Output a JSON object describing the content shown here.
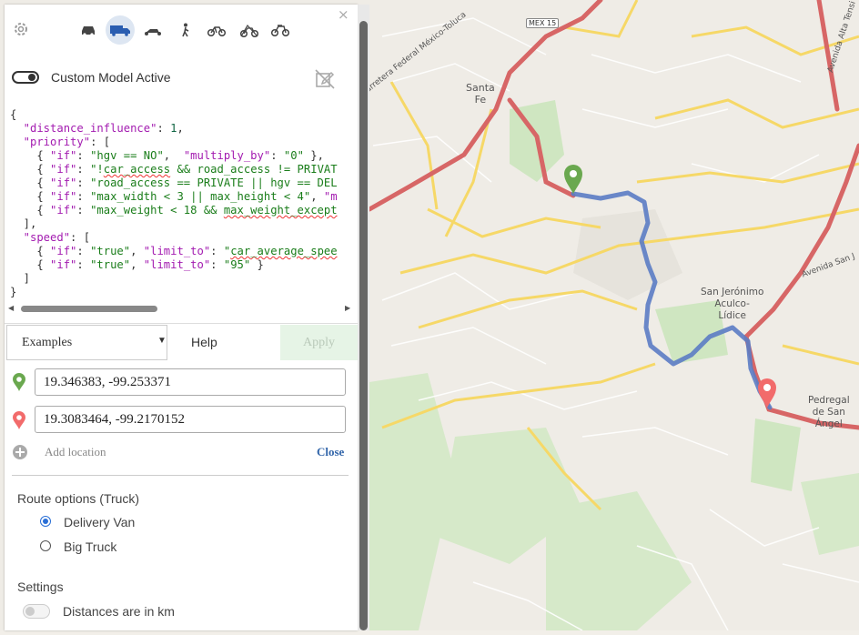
{
  "map": {
    "places": [
      {
        "id": "santa-fe",
        "lines": [
          "Santa",
          "Fe"
        ]
      },
      {
        "id": "san-jeronimo",
        "lines": [
          "San Jerónimo",
          "Aculco-",
          "Lídice"
        ]
      },
      {
        "id": "pedregal",
        "lines": [
          "Pedregal",
          "de San",
          "Ángel"
        ]
      }
    ],
    "roads": {
      "carretera": "Carretera Federal México-Toluca",
      "avenida_alta": "Avenida Alta Tensi",
      "avenida_san_j": "Avenida San J"
    },
    "shield": "MEX 15",
    "start_color": "#6aa84f",
    "end_color": "#f26b6b",
    "route_color": "#5b7cc4"
  },
  "panel": {
    "close_symbol": "×",
    "vehicles": [
      {
        "icon": "car-icon",
        "active": false
      },
      {
        "icon": "truck-icon",
        "active": true
      },
      {
        "icon": "scooter-icon",
        "active": false
      },
      {
        "icon": "walk-icon",
        "active": false
      },
      {
        "icon": "bike-icon",
        "active": false
      },
      {
        "icon": "mountain-bike-icon",
        "active": false
      },
      {
        "icon": "racing-bike-icon",
        "active": false
      }
    ],
    "custom_model_label": "Custom Model Active",
    "code": [
      "{",
      "  \"distance_influence\": 1,",
      "  \"priority\": [",
      "    { \"if\": \"hgv == NO\",  \"multiply_by\": \"0\" },",
      "    { \"if\": \"!car_access && road_access != PRIVAT",
      "    { \"if\": \"road_access == PRIVATE || hgv == DEL",
      "    { \"if\": \"max_width < 3 || max_height < 4\", \"m",
      "    { \"if\": \"max_weight < 18 && max_weight_except",
      "  ],",
      "  \"speed\": [",
      "    { \"if\": \"true\", \"limit_to\": \"car_average_spee",
      "    { \"if\": \"true\", \"limit_to\": \"95\" }",
      "  ]",
      "}"
    ],
    "examples_label": "Examples",
    "help_label": "Help",
    "apply_label": "Apply",
    "from_value": "19.346383, -99.253371",
    "to_value": "19.3083464, -99.2170152",
    "add_location_label": "Add location",
    "close_label": "Close",
    "route_options_title": "Route options (Truck)",
    "route_options": [
      {
        "label": "Delivery Van",
        "selected": true
      },
      {
        "label": "Big Truck",
        "selected": false
      }
    ],
    "settings_title": "Settings",
    "distances_label": "Distances are in km"
  }
}
